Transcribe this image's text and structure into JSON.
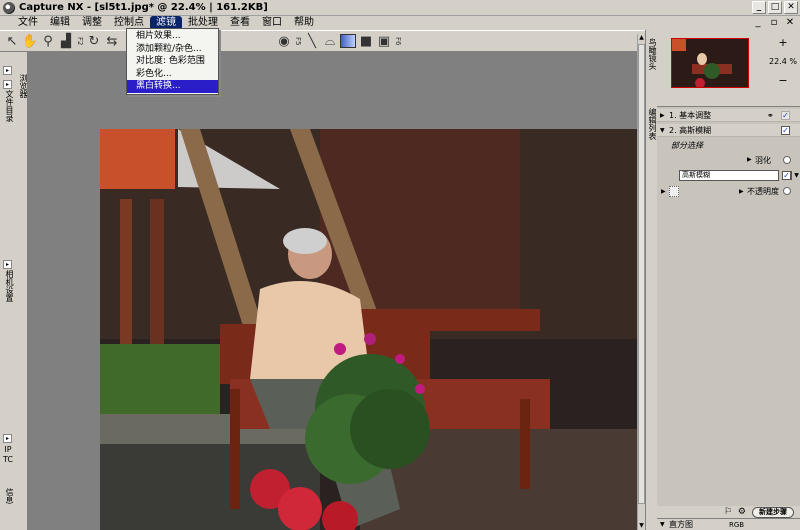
{
  "window": {
    "title": "Capture NX - [sl5t1.jpg* @ 22.4% | 161.2KB]",
    "buttons": [
      "_",
      "□",
      "✕"
    ]
  },
  "menu": {
    "items": [
      "文件",
      "编辑",
      "调整",
      "控制点",
      "滤镜",
      "批处理",
      "查看",
      "窗口",
      "帮助"
    ],
    "active_index": 4
  },
  "filter_menu": {
    "items": [
      "相片效果...",
      "添加颗粒/杂色...",
      "对比度: 色彩范围",
      "彩色化...",
      "黑白转换..."
    ],
    "highlighted_index": 4
  },
  "left_tabs": {
    "browser": "浏览器",
    "folders": "文件目录",
    "camera_settings": "相机设置",
    "iptc": "IPTC",
    "info": "信息"
  },
  "right_panel": {
    "birdseye_tab": "鸟瞰镜头",
    "edit_list_tab": "编辑列表",
    "zoom_level": "22.4 %",
    "zoom_in": "+",
    "zoom_out": "−",
    "steps": [
      {
        "label": "1. 基本调整"
      },
      {
        "label": "2. 高斯模糊"
      }
    ],
    "partial_select": "部分选择",
    "feather_label": "羽化",
    "blend_mode": "高斯模糊",
    "opacity_label": "不透明度",
    "new_step_label": "新建步骤",
    "histogram_label": "直方图",
    "histogram_channel": "RGB"
  },
  "colors": {
    "accent": "#0a246a",
    "menu_highlight": "#2a1ec8",
    "canvas_bg": "#808080"
  }
}
